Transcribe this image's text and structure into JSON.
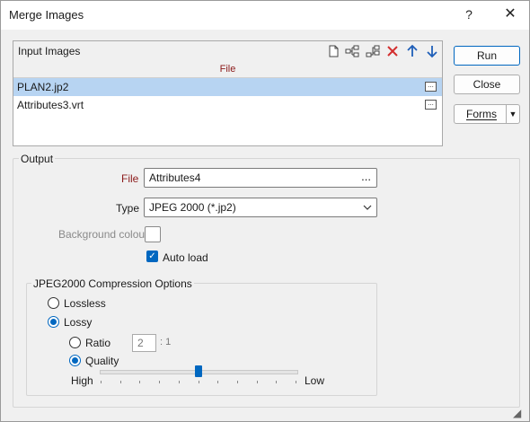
{
  "window": {
    "title": "Merge Images",
    "help_label": "?",
    "close_label": "✕"
  },
  "input_images": {
    "title": "Input Images",
    "column_header": "File",
    "toolbar": [
      "new-file-icon",
      "insert-row-icon",
      "add-row-icon",
      "delete-icon",
      "move-up-icon",
      "move-down-icon"
    ],
    "rows": [
      {
        "name": "PLAN2.jp2",
        "selected": true
      },
      {
        "name": "Attributes3.vrt",
        "selected": false
      }
    ],
    "row_browse_label": "..."
  },
  "buttons": {
    "run": "Run",
    "close": "Close",
    "forms": "Forms"
  },
  "output": {
    "group_label": "Output",
    "file_label": "File",
    "file_value": "Attributes4",
    "file_browse": "...",
    "type_label": "Type",
    "type_value": "JPEG 2000 (*.jp2)",
    "background_label": "Background colour",
    "autoload_label": "Auto load",
    "autoload_checked": true
  },
  "jpeg2000": {
    "group_label": "JPEG2000 Compression Options",
    "lossless_label": "Lossless",
    "lossy_label": "Lossy",
    "mode": "Lossy",
    "ratio_label": "Ratio",
    "ratio_value": "2",
    "ratio_suffix": ": 1",
    "quality_label": "Quality",
    "quality_selected": true,
    "slider_low_label": "High",
    "slider_high_label": "Low",
    "slider_position": 0.5
  },
  "colors": {
    "accent": "#0067c0",
    "selection": "#b7d4f2",
    "required_label": "#8b1a1a",
    "delete_red": "#d32f2f"
  }
}
